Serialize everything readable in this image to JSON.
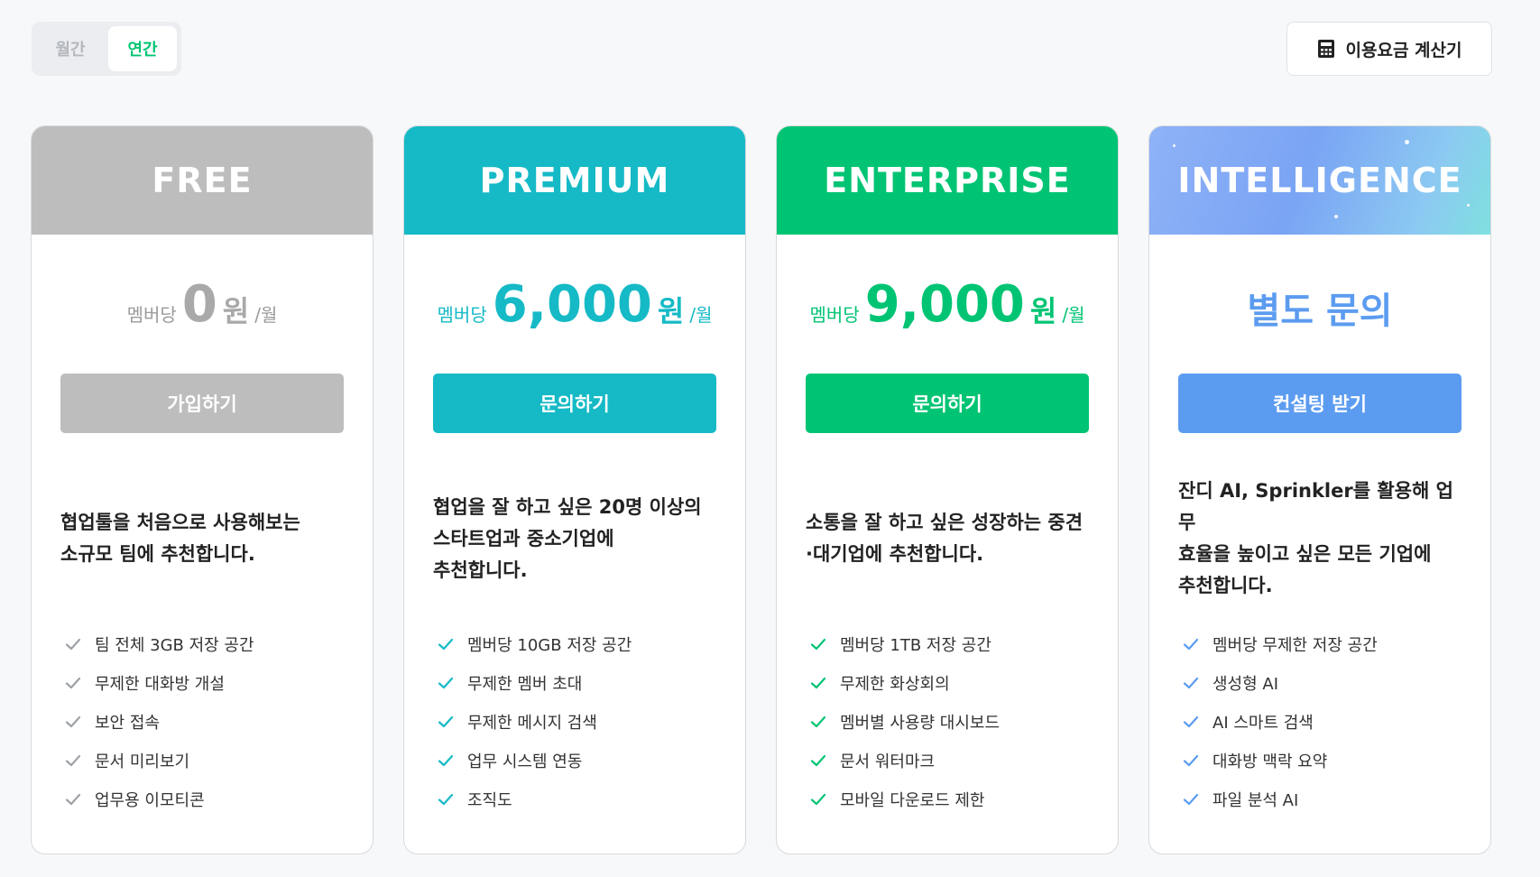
{
  "billing_toggle": {
    "monthly_label": "월간",
    "yearly_label": "연간",
    "selected": "연간"
  },
  "calculator_button": {
    "label": "이용요금 계산기",
    "icon": "calculator-icon"
  },
  "plans": [
    {
      "name": "FREE",
      "header_color": "#bdbdbd",
      "accent_color": "#a9a9a9",
      "price": {
        "per_label": "멤버당",
        "amount": "0",
        "currency": "원",
        "unit": "/월"
      },
      "cta_label": "가입하기",
      "cta_color": "#bdbdbd",
      "description": "협업툴을 처음으로 사용해보는\n소규모 팀에 추천합니다.",
      "features": [
        "팀 전체 3GB 저장 공간",
        "무제한 대화방 개설",
        "보안 접속",
        "문서 미리보기",
        "업무용 이모티콘"
      ]
    },
    {
      "name": "PREMIUM",
      "header_color": "#15bac6",
      "accent_color": "#15bac6",
      "price": {
        "per_label": "멤버당",
        "amount": "6,000",
        "currency": "원",
        "unit": "/월"
      },
      "cta_label": "문의하기",
      "cta_color": "#15bac6",
      "description": "협업을 잘 하고 싶은 20명 이상의\n스타트업과 중소기업에\n추천합니다.",
      "features": [
        "멤버당 10GB 저장 공간",
        "무제한 멤버 초대",
        "무제한 메시지 검색",
        "업무 시스템 연동",
        "조직도"
      ]
    },
    {
      "name": "ENTERPRISE",
      "header_color": "#00c473",
      "accent_color": "#00c473",
      "price": {
        "per_label": "멤버당",
        "amount": "9,000",
        "currency": "원",
        "unit": "/월"
      },
      "cta_label": "문의하기",
      "cta_color": "#00c473",
      "description": "소통을 잘 하고 싶은 성장하는 중견\n·대기업에 추천합니다.",
      "features": [
        "멤버당 1TB 저장 공간",
        "무제한 화상회의",
        "멤버별 사용량 대시보드",
        "문서 워터마크",
        "모바일 다운로드 제한"
      ]
    },
    {
      "name": "INTELLIGENCE",
      "header_color": "#7aa8f5",
      "accent_color": "#5c9cf0",
      "price_text": "별도 문의",
      "cta_label": "컨설팅 받기",
      "cta_color": "#5c9cf0",
      "description": "잔디 AI, Sprinkler를 활용해 업무\n효율을 높이고 싶은 모든 기업에\n추천합니다.",
      "features": [
        "멤버당 무제한 저장 공간",
        "생성형 AI",
        "AI 스마트 검색",
        "대화방 맥락 요약",
        "파일 분석 AI"
      ]
    }
  ]
}
